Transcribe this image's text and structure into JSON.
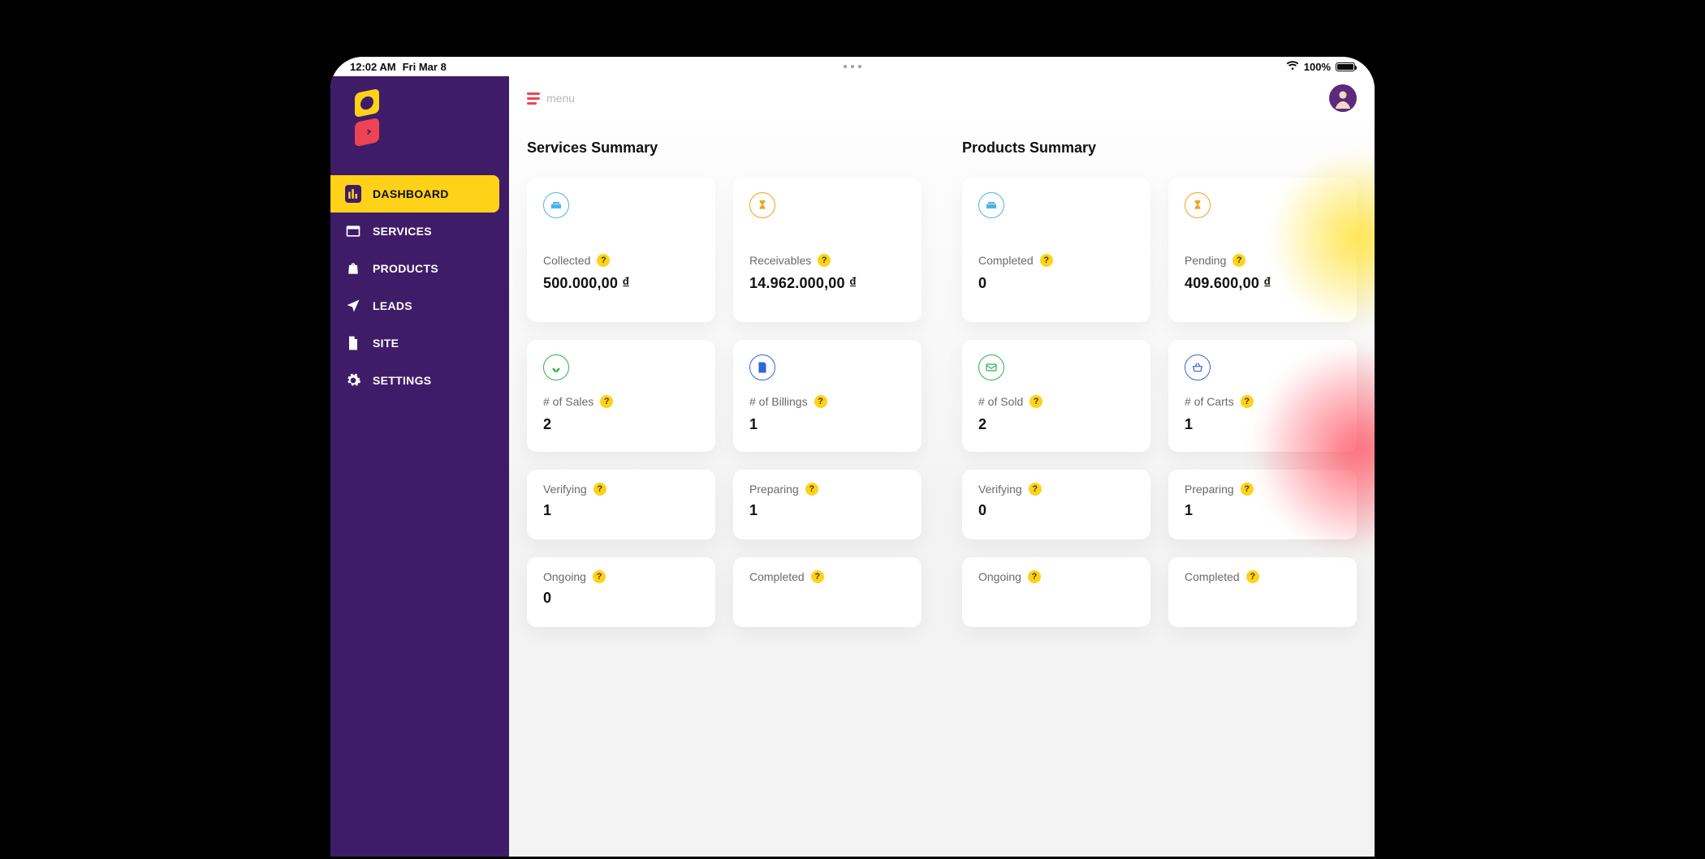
{
  "status": {
    "time": "12:02 AM",
    "date": "Fri Mar 8",
    "battery": "100%"
  },
  "topbar": {
    "menu_label": "menu"
  },
  "sidebar": {
    "items": [
      {
        "label": "DASHBOARD"
      },
      {
        "label": "SERVICES"
      },
      {
        "label": "PRODUCTS"
      },
      {
        "label": "LEADS"
      },
      {
        "label": "SITE"
      },
      {
        "label": "SETTINGS"
      }
    ]
  },
  "sections": {
    "services": {
      "title": "Services Summary",
      "cards": {
        "collected": {
          "label": "Collected",
          "value": "500.000,00 ₫"
        },
        "receivables": {
          "label": "Receivables",
          "value": "14.962.000,00 ₫"
        },
        "sales": {
          "label": "# of Sales",
          "value": "2"
        },
        "billings": {
          "label": "# of Billings",
          "value": "1"
        },
        "verifying": {
          "label": "Verifying",
          "value": "1"
        },
        "preparing": {
          "label": "Preparing",
          "value": "1"
        },
        "ongoing": {
          "label": "Ongoing",
          "value": "0"
        },
        "completed": {
          "label": "Completed",
          "value": ""
        }
      }
    },
    "products": {
      "title": "Products Summary",
      "cards": {
        "completed_top": {
          "label": "Completed",
          "value": "0"
        },
        "pending": {
          "label": "Pending",
          "value": "409.600,00 ₫"
        },
        "sold": {
          "label": "# of Sold",
          "value": "2"
        },
        "carts": {
          "label": "# of Carts",
          "value": "1"
        },
        "verifying": {
          "label": "Verifying",
          "value": "0"
        },
        "preparing": {
          "label": "Preparing",
          "value": "1"
        },
        "ongoing": {
          "label": "Ongoing",
          "value": ""
        },
        "completed": {
          "label": "Completed",
          "value": ""
        }
      }
    }
  },
  "help_glyph": "?"
}
